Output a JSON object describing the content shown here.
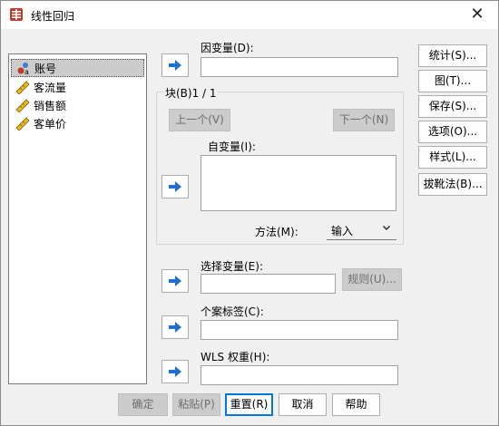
{
  "window": {
    "title": "线性回归",
    "close_glyph": "✕"
  },
  "variables": [
    {
      "label": "账号",
      "icon": "nominal-variable-icon",
      "selected": true
    },
    {
      "label": "客流量",
      "icon": "scale-variable-icon",
      "selected": false
    },
    {
      "label": "销售额",
      "icon": "scale-variable-icon",
      "selected": false
    },
    {
      "label": "客单价",
      "icon": "scale-variable-icon",
      "selected": false
    }
  ],
  "dependent": {
    "label": "因变量(D):",
    "value": ""
  },
  "block": {
    "title": "块(B)1 / 1",
    "prev_label": "上一个(V)",
    "next_label": "下一个(N)",
    "independent_label": "自变量(I):",
    "method_label": "方法(M):",
    "method_value": "输入"
  },
  "selection": {
    "label": "选择变量(E):",
    "rule_label": "规则(U)..."
  },
  "case_labels": {
    "label": "个案标签(C):"
  },
  "wls": {
    "label": "WLS 权重(H):"
  },
  "side_buttons": [
    "统计(S)...",
    "图(T)...",
    "保存(S)...",
    "选项(O)...",
    "样式(L)...",
    "拔靴法(B)..."
  ],
  "bottom_buttons": {
    "ok": "确定",
    "paste": "粘贴(P)",
    "reset": "重置(R)",
    "cancel": "取消",
    "help": "帮助"
  },
  "colors": {
    "accent": "#0078d7",
    "arrow": "#1f6fd1",
    "disabled_bg": "#cccccc"
  }
}
